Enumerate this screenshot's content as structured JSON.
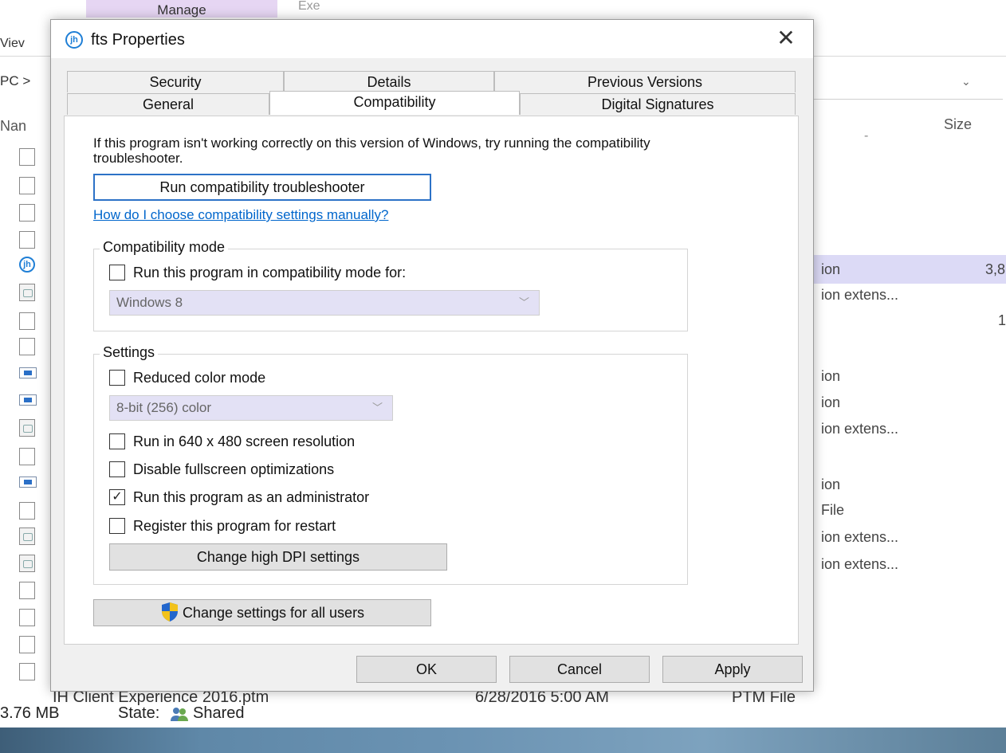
{
  "explorer": {
    "ribbon_manage": "Manage",
    "ribbon_exe": "Exe",
    "view_tab": "Viev",
    "address_left": "PC >",
    "address_chevron": "⌄",
    "column_name": "Nan",
    "column_size": "Size",
    "column_dash": "-",
    "rows": [
      {
        "type": "ion",
        "size": "3,8"
      },
      {
        "type": "ion extens...",
        "size": ""
      },
      {
        "type": "",
        "size": "1"
      },
      {
        "type": "ion",
        "size": ""
      },
      {
        "type": "ion",
        "size": ""
      },
      {
        "type": "ion extens...",
        "size": ""
      },
      {
        "type": "ion",
        "size": ""
      },
      {
        "type": "File",
        "size": ""
      },
      {
        "type": "ion extens...",
        "size": ""
      },
      {
        "type": "ion extens...",
        "size": ""
      }
    ],
    "bottom_row": {
      "name": "IH Client Experience 2016.ptm",
      "date": "6/28/2016 5:00 AM",
      "type": "PTM File"
    },
    "status": {
      "size": "3.76 MB",
      "state_label": "State:",
      "state_value": "Shared"
    }
  },
  "dialog": {
    "icon_text": "jh",
    "title": "fts Properties",
    "close_glyph": "✕",
    "tabs_row1": [
      "Security",
      "Details",
      "Previous Versions"
    ],
    "tabs_row2": [
      "General",
      "Compatibility",
      "Digital Signatures"
    ],
    "active_tab": "Compatibility",
    "intro": "If this program isn't working correctly on this version of Windows, try running the compatibility troubleshooter.",
    "troubleshooter_button": "Run compatibility troubleshooter",
    "help_link": "How do I choose compatibility settings manually?",
    "compat_mode": {
      "group_label": "Compatibility mode",
      "checkbox_label": "Run this program in compatibility mode for:",
      "checked": false,
      "select_value": "Windows 8"
    },
    "settings": {
      "group_label": "Settings",
      "reduced_color": {
        "label": "Reduced color mode",
        "checked": false
      },
      "color_select": "8-bit (256) color",
      "resolution": {
        "label": "Run in 640 x 480 screen resolution",
        "checked": false
      },
      "fullscreen": {
        "label": "Disable fullscreen optimizations",
        "checked": false
      },
      "admin": {
        "label": "Run this program as an administrator",
        "checked": true
      },
      "restart": {
        "label": "Register this program for restart",
        "checked": false
      },
      "dpi_button": "Change high DPI settings"
    },
    "all_users_button": "Change settings for all users",
    "ok_button": "OK",
    "cancel_button": "Cancel",
    "apply_button": "Apply",
    "check_glyph": "✓",
    "chevron_glyph": "﹀"
  },
  "colors": {
    "accent": "#2c72c7",
    "link": "#0066cc",
    "highlight_row": "#dcdaf6",
    "disabled_select": "#e3e1f5"
  }
}
